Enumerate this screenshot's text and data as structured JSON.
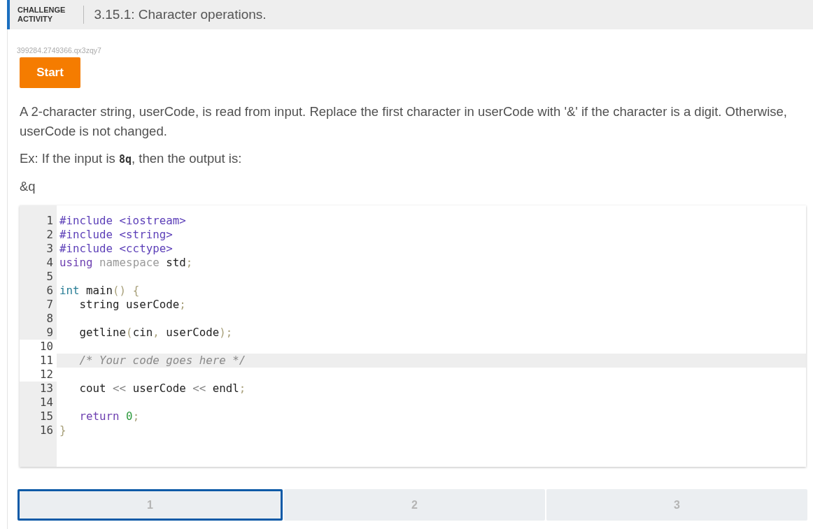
{
  "header": {
    "label_lines": [
      "CHALLENGE",
      "ACTIVITY"
    ],
    "title": "3.15.1: Character operations."
  },
  "activity_id": "399284.2749366.qx3zqy7",
  "start_button": "Start",
  "prompt": "A 2-character string, userCode, is read from input. Replace the first character in userCode with '&' if the character is a digit. Otherwise, userCode is not changed.",
  "example": "Ex: If the input is **8q**, then the output is:",
  "example_output": "&q",
  "code_lines": [
    {
      "number": "1",
      "editable": false,
      "highlighted": false,
      "tokens": [
        {
          "kind": "meta",
          "text": "#include <iostream>"
        }
      ]
    },
    {
      "number": "2",
      "editable": false,
      "highlighted": false,
      "tokens": [
        {
          "kind": "meta",
          "text": "#include <string>"
        }
      ]
    },
    {
      "number": "3",
      "editable": false,
      "highlighted": false,
      "tokens": [
        {
          "kind": "meta",
          "text": "#include <cctype>"
        }
      ]
    },
    {
      "number": "4",
      "editable": false,
      "highlighted": false,
      "tokens": [
        {
          "kind": "keyword",
          "text": "using "
        },
        {
          "kind": "dim",
          "text": "namespace"
        },
        {
          "kind": "plain",
          "text": " std"
        },
        {
          "kind": "punct",
          "text": ";"
        }
      ]
    },
    {
      "number": "5",
      "editable": false,
      "highlighted": false
    },
    {
      "number": "6",
      "editable": false,
      "highlighted": false,
      "tokens": [
        {
          "kind": "type",
          "text": "int"
        },
        {
          "kind": "plain",
          "text": " main"
        },
        {
          "kind": "punct",
          "text": "() {"
        }
      ]
    },
    {
      "number": "7",
      "editable": false,
      "highlighted": false,
      "tokens": [
        {
          "kind": "plain",
          "text": "   string userCode"
        },
        {
          "kind": "punct",
          "text": ";"
        }
      ]
    },
    {
      "number": "8",
      "editable": false,
      "highlighted": false
    },
    {
      "number": "9",
      "editable": false,
      "highlighted": false,
      "tokens": [
        {
          "kind": "plain",
          "text": "   getline"
        },
        {
          "kind": "punct",
          "text": "("
        },
        {
          "kind": "plain",
          "text": "cin"
        },
        {
          "kind": "punct",
          "text": ", "
        },
        {
          "kind": "plain",
          "text": "userCode"
        },
        {
          "kind": "punct",
          "text": ");"
        }
      ]
    },
    {
      "number": "10",
      "editable": true,
      "highlighted": false
    },
    {
      "number": "11",
      "editable": true,
      "highlighted": true,
      "tokens": [
        {
          "kind": "comment",
          "text": "   /* Your code goes here */"
        }
      ]
    },
    {
      "number": "12",
      "editable": true,
      "highlighted": false
    },
    {
      "number": "13",
      "editable": false,
      "highlighted": false,
      "tokens": [
        {
          "kind": "plain",
          "text": "   cout "
        },
        {
          "kind": "operator",
          "text": "<<"
        },
        {
          "kind": "plain",
          "text": " userCode "
        },
        {
          "kind": "operator",
          "text": "<<"
        },
        {
          "kind": "plain",
          "text": " endl"
        },
        {
          "kind": "punct",
          "text": ";"
        }
      ]
    },
    {
      "number": "14",
      "editable": false,
      "highlighted": false
    },
    {
      "number": "15",
      "editable": false,
      "highlighted": false,
      "tokens": [
        {
          "kind": "keyword",
          "text": "   return "
        },
        {
          "kind": "number",
          "text": "0"
        },
        {
          "kind": "punct",
          "text": ";"
        }
      ]
    },
    {
      "number": "16",
      "editable": false,
      "highlighted": false,
      "tokens": [
        {
          "kind": "punct",
          "text": "}"
        }
      ]
    }
  ],
  "steps": [
    {
      "label": "1",
      "selected": true
    },
    {
      "label": "2",
      "selected": false
    },
    {
      "label": "3",
      "selected": false
    }
  ]
}
